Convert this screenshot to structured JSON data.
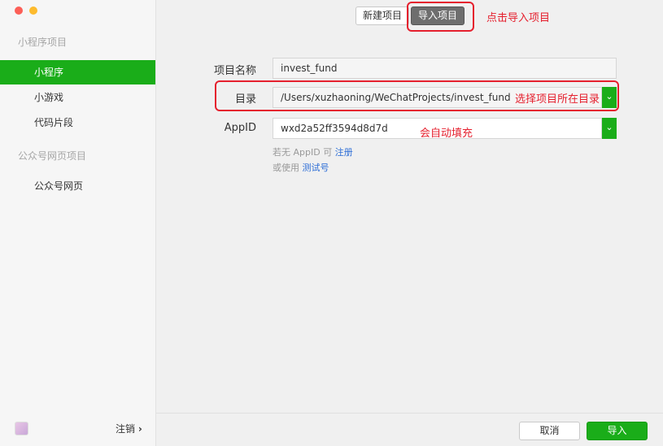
{
  "sidebar": {
    "section_miniprogram": "小程序项目",
    "items_mini": [
      {
        "label": "小程序"
      },
      {
        "label": "小游戏"
      },
      {
        "label": "代码片段"
      }
    ],
    "section_official": "公众号网页项目",
    "items_official": [
      {
        "label": "公众号网页"
      }
    ],
    "logout_label": "注销",
    "logout_chevron": "›"
  },
  "topbar": {
    "new_project": "新建项目",
    "import_project": "导入项目"
  },
  "annotations": {
    "click_import": "点击导入项目",
    "choose_dir": "选择项目所在目录",
    "auto_fill": "会自动填充"
  },
  "form": {
    "project_name_label": "项目名称",
    "project_name_value": "invest_fund",
    "directory_label": "目录",
    "directory_value": "/Users/xuzhaoning/WeChatProjects/invest_fund",
    "appid_label": "AppID",
    "appid_value": "wxd2a52ff3594d8d7d",
    "hint_no_appid_prefix": "若无 AppID 可",
    "hint_register_link": "注册",
    "hint_or_use_prefix": "或使用",
    "hint_test_link": "测试号"
  },
  "footer": {
    "cancel": "取消",
    "import": "导入"
  },
  "colors": {
    "accent": "#1aad19",
    "annotation": "#e5202e"
  }
}
